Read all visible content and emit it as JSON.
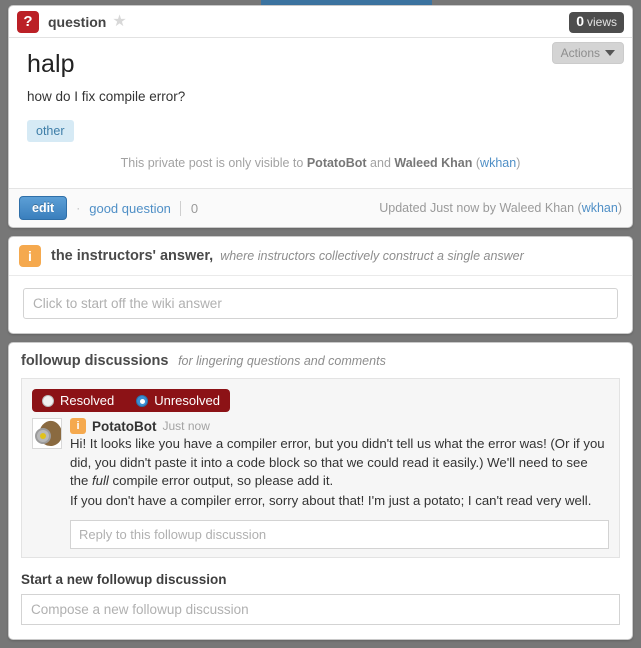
{
  "window": {
    "accent_blue": "#3b73a0"
  },
  "question": {
    "type_icon": "question-mark-icon",
    "type_icon_glyph": "?",
    "type_label": "question",
    "star_icon": "star-icon",
    "star_glyph": "★",
    "views_count": "0",
    "views_label": "views",
    "actions_label": "Actions",
    "title": "halp",
    "body": "how do I fix compile error?",
    "tags": [
      "other"
    ],
    "private_note": {
      "prefix": "This private post is only visible to ",
      "user1": "PotatoBot",
      "middle": " and ",
      "user2": "Waleed Khan",
      "open_paren": " (",
      "handle": "wkhan",
      "close_paren": ")"
    },
    "footer": {
      "edit_label": "edit",
      "separator": "·",
      "good_question_label": "good question",
      "good_question_count": "0",
      "updated_prefix": "Updated Just now by Waleed Khan (",
      "updated_handle": "wkhan",
      "updated_suffix": ")"
    }
  },
  "instructors_answer": {
    "icon": "info-icon",
    "icon_glyph": "i",
    "title": "the instructors' answer,",
    "subtitle": "where instructors collectively construct a single answer",
    "placeholder": "Click to start off the wiki answer"
  },
  "followup": {
    "title": "followup discussions",
    "subtitle": "for lingering questions and comments",
    "resolve_toggle": {
      "resolved_label": "Resolved",
      "resolved_selected": false,
      "unresolved_label": "Unresolved",
      "unresolved_selected": true
    },
    "discussion": {
      "avatar": "potato-avatar",
      "author_badge": "instructor-info-icon",
      "author_badge_glyph": "i",
      "author": "PotatoBot",
      "timestamp": "Just now",
      "paragraph1_part1": "Hi! It looks like you have a compiler error, but you didn't tell us what the error was! (Or if you did, you didn't paste it into a code block so that we could read it easily.) We'll need to see the ",
      "paragraph1_emphasis": "full",
      "paragraph1_part2": " compile error output, so please add it.",
      "paragraph2": "If you don't have a compiler error, sorry about that! I'm just a potato; I can't read very well.",
      "reply_placeholder": "Reply to this followup discussion"
    },
    "new_discussion_label": "Start a new followup discussion",
    "new_discussion_placeholder": "Compose a new followup discussion"
  }
}
